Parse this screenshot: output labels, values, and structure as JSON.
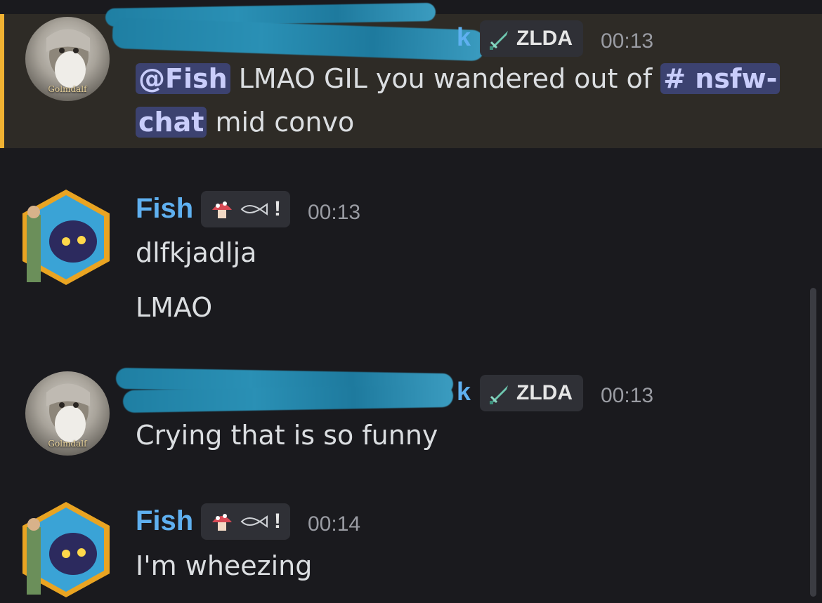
{
  "messages": [
    {
      "author_tail": "k",
      "role": "ZLDA",
      "time": "00:13",
      "avatar_caption": "Golmdalf",
      "parts": {
        "mention": "@Fish",
        "text_a": "LMAO GIL you wandered out of",
        "channel_a": "# nsfw-",
        "channel_b": "chat",
        "text_b": "mid convo"
      }
    },
    {
      "author": "Fish",
      "badge_mark": "!",
      "time": "00:13",
      "lines": [
        "dlfkjadlja",
        "LMAO"
      ]
    },
    {
      "author_tail": "k",
      "role": "ZLDA",
      "time": "00:13",
      "avatar_caption": "Golmdalf",
      "lines": [
        "Crying that is so funny"
      ]
    },
    {
      "author": "Fish",
      "badge_mark": "!",
      "time": "00:14",
      "lines": [
        "I'm wheezing"
      ]
    }
  ],
  "icons": {
    "role": "sword-icon",
    "badge": [
      "mushroom-icon",
      "fish-icon"
    ]
  },
  "colors": {
    "username": "#5fb0f0",
    "highlight_bar": "#f0b232",
    "mention_bg": "#3c4270",
    "background": "#1a1a1e"
  }
}
